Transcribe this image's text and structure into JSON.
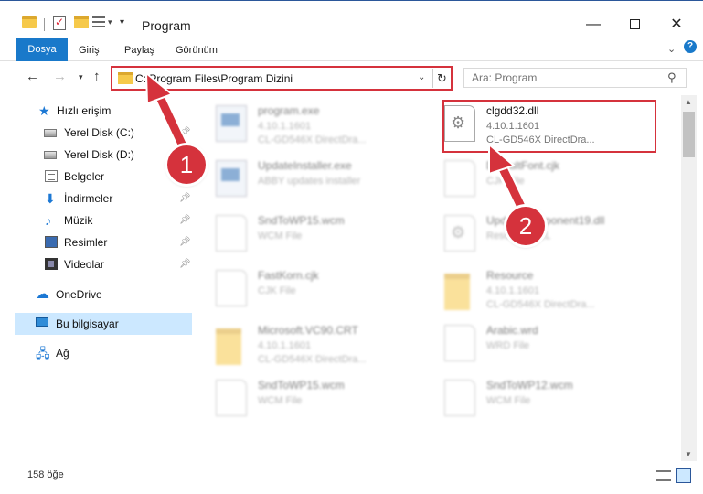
{
  "window": {
    "title": "Program"
  },
  "ribbon": {
    "tabs": [
      "Dosya",
      "Giriş",
      "Paylaş",
      "Görünüm"
    ]
  },
  "address": {
    "path": "C:\\Program Files\\Program Dizini"
  },
  "search": {
    "placeholder": "Ara: Program"
  },
  "nav": {
    "items": [
      {
        "label": "Hızlı erişim",
        "icon": "star-icon"
      },
      {
        "label": "Yerel Disk (C:)",
        "icon": "disk-icon",
        "pinned": true
      },
      {
        "label": "Yerel Disk (D:)",
        "icon": "disk-icon"
      },
      {
        "label": "Belgeler",
        "icon": "documents-icon"
      },
      {
        "label": "İndirmeler",
        "icon": "download-icon",
        "pinned": true
      },
      {
        "label": "Müzik",
        "icon": "music-icon",
        "pinned": true
      },
      {
        "label": "Resimler",
        "icon": "pictures-icon",
        "pinned": true
      },
      {
        "label": "Videolar",
        "icon": "video-icon",
        "pinned": true
      },
      {
        "label": "OneDrive",
        "icon": "cloud-icon"
      },
      {
        "label": "Bu bilgisayar",
        "icon": "computer-icon",
        "selected": true
      },
      {
        "label": "Ağ",
        "icon": "network-icon"
      }
    ]
  },
  "files": [
    {
      "name": "program.exe",
      "line1": "4.10.1.1601",
      "line2": "CL-GD546X DirectDra...",
      "icon": "exe-icon",
      "blurred": true
    },
    {
      "name": "clgdd32.dll",
      "line1": "4.10.1.1601",
      "line2": "CL-GD546X DirectDra...",
      "icon": "dll-gear-icon",
      "blurred": false
    },
    {
      "name": "UpdateInstaller.exe",
      "line1": "ABBY updates installer",
      "line2": "",
      "icon": "exe-icon",
      "blurred": true
    },
    {
      "name": "DefaultFont.cjk",
      "line1": "CJK File",
      "line2": "",
      "icon": "file-icon",
      "blurred": true
    },
    {
      "name": "SndToWP15.wcm",
      "line1": "WCM File",
      "line2": "",
      "icon": "file-icon",
      "blurred": true
    },
    {
      "name": "UpdateComponent19.dll",
      "line1": "Resource DLL",
      "line2": "",
      "icon": "dll-gear-icon",
      "blurred": true
    },
    {
      "name": "FastKorn.cjk",
      "line1": "CJK File",
      "line2": "",
      "icon": "file-icon",
      "blurred": true
    },
    {
      "name": "Resource",
      "line1": "4.10.1.1601",
      "line2": "CL-GD546X DirectDra...",
      "icon": "folder-icon",
      "blurred": true
    },
    {
      "name": "Microsoft.VC90.CRT",
      "line1": "4.10.1.1601",
      "line2": "CL-GD546X DirectDra...",
      "icon": "folder-icon",
      "blurred": true
    },
    {
      "name": "Arabic.wrd",
      "line1": "WRD File",
      "line2": "",
      "icon": "file-icon",
      "blurred": true
    },
    {
      "name": "SndToWP15.wcm",
      "line1": "WCM File",
      "line2": "",
      "icon": "file-icon",
      "blurred": true
    },
    {
      "name": "SndToWP12.wcm",
      "line1": "WCM File",
      "line2": "",
      "icon": "file-icon",
      "blurred": true
    }
  ],
  "status": {
    "count": "158 öğe"
  },
  "callouts": [
    "1",
    "2"
  ],
  "colors": {
    "accent": "#1979ca",
    "highlight": "#d5323c",
    "selection": "#cce8ff"
  }
}
